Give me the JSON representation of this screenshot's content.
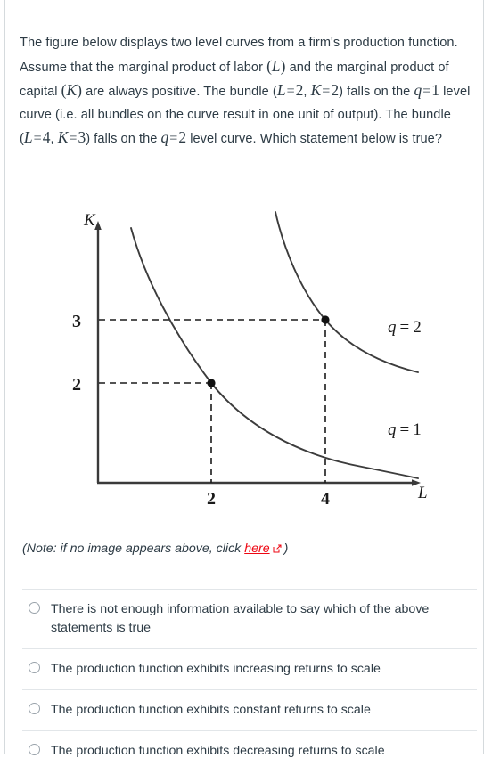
{
  "question": {
    "stem_lines": [
      "The figure below displays two level curves from a firm's production",
      "function. Assume that the marginal product of labor (L) and the marginal",
      "product of capital (K) are always positive. The bundle (L = 2, K = 2)",
      "falls on the q = 1 level curve (i.e. all bundles on the curve result in one",
      "unit of output). The bundle (L = 4, K = 3) falls on the q = 2 level",
      "curve. Which statement below is true?"
    ],
    "text_color": "#2d3b45"
  },
  "note": {
    "prefix": "(Note: if no image appears above, click ",
    "link_text": "here",
    "link_color": "#ee0612",
    "icon": "external-link-icon",
    "suffix": ")"
  },
  "answers": {
    "options": [
      {
        "label": "There is not enough information available to say which of the above statements is true",
        "selected": false
      },
      {
        "label": "The production function exhibits increasing returns to scale",
        "selected": false
      },
      {
        "label": "The production function exhibits constant returns to scale",
        "selected": false
      },
      {
        "label": "The production function exhibits decreasing returns to scale",
        "selected": false
      }
    ]
  },
  "chart_data": {
    "type": "line",
    "title": "",
    "xlabel": "L",
    "ylabel": "K",
    "xlim": [
      0,
      5.65
    ],
    "ylim": [
      0,
      4.55
    ],
    "grid": false,
    "axis_style": "arrowed-spines",
    "xticks": [
      2,
      4
    ],
    "xtick_labels": [
      "2",
      "4"
    ],
    "yticks": [
      2,
      3
    ],
    "ytick_labels": [
      "2",
      "3"
    ],
    "series": [
      {
        "name": "q = 1",
        "label": "q = 1",
        "label_position": [
          4.85,
          1.27
        ],
        "comment": "isoquant through (2,2); K = 4/L style hyperbola",
        "x": [
          0.6,
          0.75,
          0.95,
          1.2,
          1.5,
          1.75,
          2.0,
          2.5,
          3.0,
          3.5,
          4.0,
          4.5,
          5.0,
          5.6
        ],
        "y": [
          4.45,
          3.85,
          3.34,
          2.93,
          2.52,
          2.27,
          2.0,
          1.72,
          1.52,
          1.36,
          1.24,
          1.14,
          1.05,
          0.95
        ]
      },
      {
        "name": "q = 2",
        "label": "q = 2",
        "label_position": [
          4.85,
          2.92
        ],
        "comment": "isoquant through (4,3); higher level curve",
        "x": [
          3.05,
          3.15,
          3.3,
          3.5,
          3.7,
          4.0,
          4.3,
          4.6,
          5.0,
          5.35,
          5.65
        ],
        "y": [
          4.55,
          4.15,
          3.8,
          3.48,
          3.24,
          3.0,
          2.82,
          2.68,
          2.53,
          2.44,
          2.37
        ]
      }
    ],
    "points": [
      {
        "name": "bundle-q1",
        "x": 2,
        "y": 2,
        "marker": "filled-circle",
        "guide_lines": "dashed-to-axes"
      },
      {
        "name": "bundle-q2",
        "x": 4,
        "y": 3,
        "marker": "filled-circle",
        "guide_lines": "dashed-to-axes"
      }
    ],
    "annotations": [
      {
        "text": "q = 2",
        "x": 4.85,
        "y": 2.92
      },
      {
        "text": "q = 1",
        "x": 4.85,
        "y": 1.27
      }
    ]
  }
}
